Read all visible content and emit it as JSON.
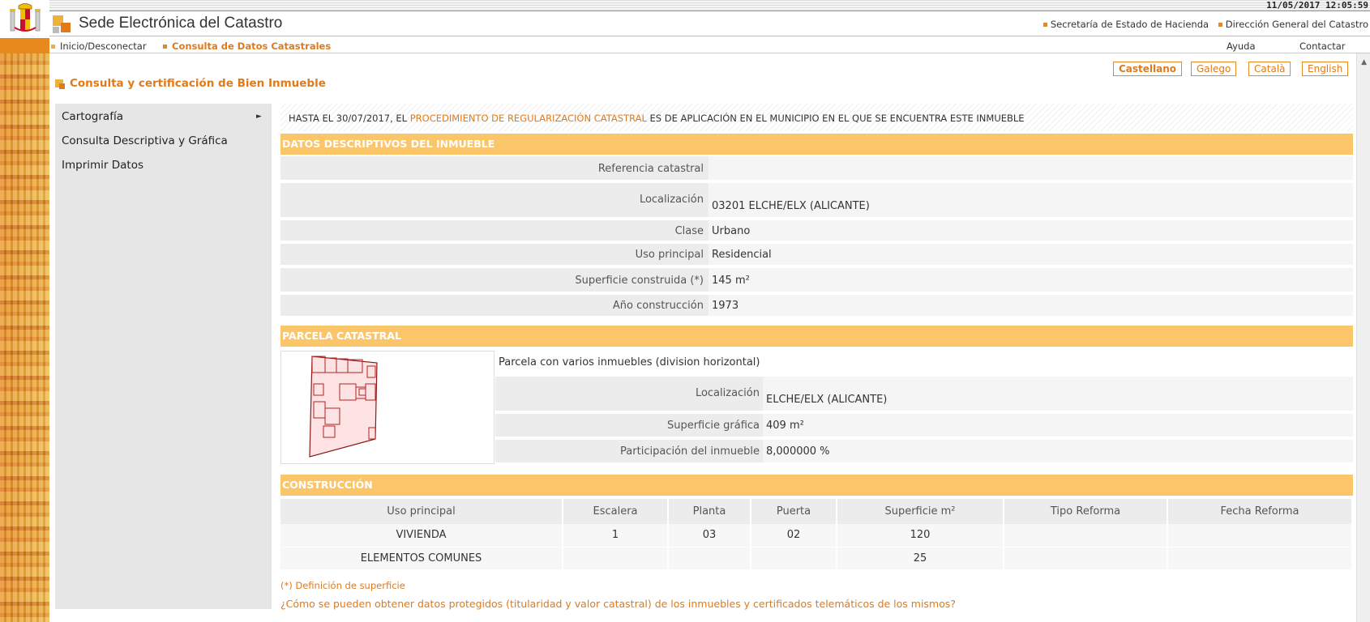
{
  "header": {
    "datetime": "11/05/2017 12:05:59",
    "site_title": "Sede Electrónica del Catastro",
    "links": [
      "Secretaría de Estado de Hacienda",
      "Dirección General del Catastro"
    ]
  },
  "nav": {
    "home": "Inicio/Desconectar",
    "active": "Consulta de Datos Catastrales",
    "help": "Ayuda",
    "contact": "Contactar"
  },
  "languages": [
    "Castellano",
    "Galego",
    "Català",
    "English"
  ],
  "page_title": "Consulta y certificación de Bien Inmueble",
  "sidebar": {
    "items": [
      "Cartografía",
      "Consulta Descriptiva y Gráfica",
      "Imprimir Datos"
    ]
  },
  "notice": {
    "before": "HASTA EL 30/07/2017, EL ",
    "highlight": "PROCEDIMIENTO DE REGULARIZACIÓN CATASTRAL",
    "after": " ES DE APLICACIÓN EN EL MUNICIPIO EN EL QUE SE ENCUENTRA ESTE INMUEBLE"
  },
  "datos": {
    "title": "DATOS DESCRIPTIVOS DEL INMUEBLE",
    "rows": [
      {
        "label": "Referencia catastral",
        "value": ""
      },
      {
        "label": "Localización",
        "value": "03201 ELCHE/ELX (ALICANTE)"
      },
      {
        "label": "Clase",
        "value": "Urbano"
      },
      {
        "label": "Uso principal",
        "value": "Residencial"
      },
      {
        "label": "Superficie construida (*)",
        "value": "145 m²"
      },
      {
        "label": "Año construcción",
        "value": "1973"
      }
    ]
  },
  "parcela": {
    "title": "PARCELA CATASTRAL",
    "description": "Parcela con varios inmuebles (division horizontal)",
    "rows": [
      {
        "label": "Localización",
        "value": "ELCHE/ELX (ALICANTE)"
      },
      {
        "label": "Superficie gráfica",
        "value": "409 m²"
      },
      {
        "label": "Participación del inmueble",
        "value": "8,000000 %"
      }
    ]
  },
  "construccion": {
    "title": "CONSTRUCCIÓN",
    "headers": [
      "Uso principal",
      "Escalera",
      "Planta",
      "Puerta",
      "Superficie m²",
      "Tipo Reforma",
      "Fecha Reforma"
    ],
    "rows": [
      [
        "VIVIENDA",
        "1",
        "03",
        "02",
        "120",
        "",
        ""
      ],
      [
        "ELEMENTOS COMUNES",
        "",
        "",
        "",
        "25",
        "",
        ""
      ]
    ]
  },
  "footer": {
    "definition_link": "(*) Definición de superficie",
    "protected_link": "¿Cómo se pueden obtener datos protegidos (titularidad y valor catastral) de los inmuebles y certificados telemáticos de los mismos?"
  }
}
